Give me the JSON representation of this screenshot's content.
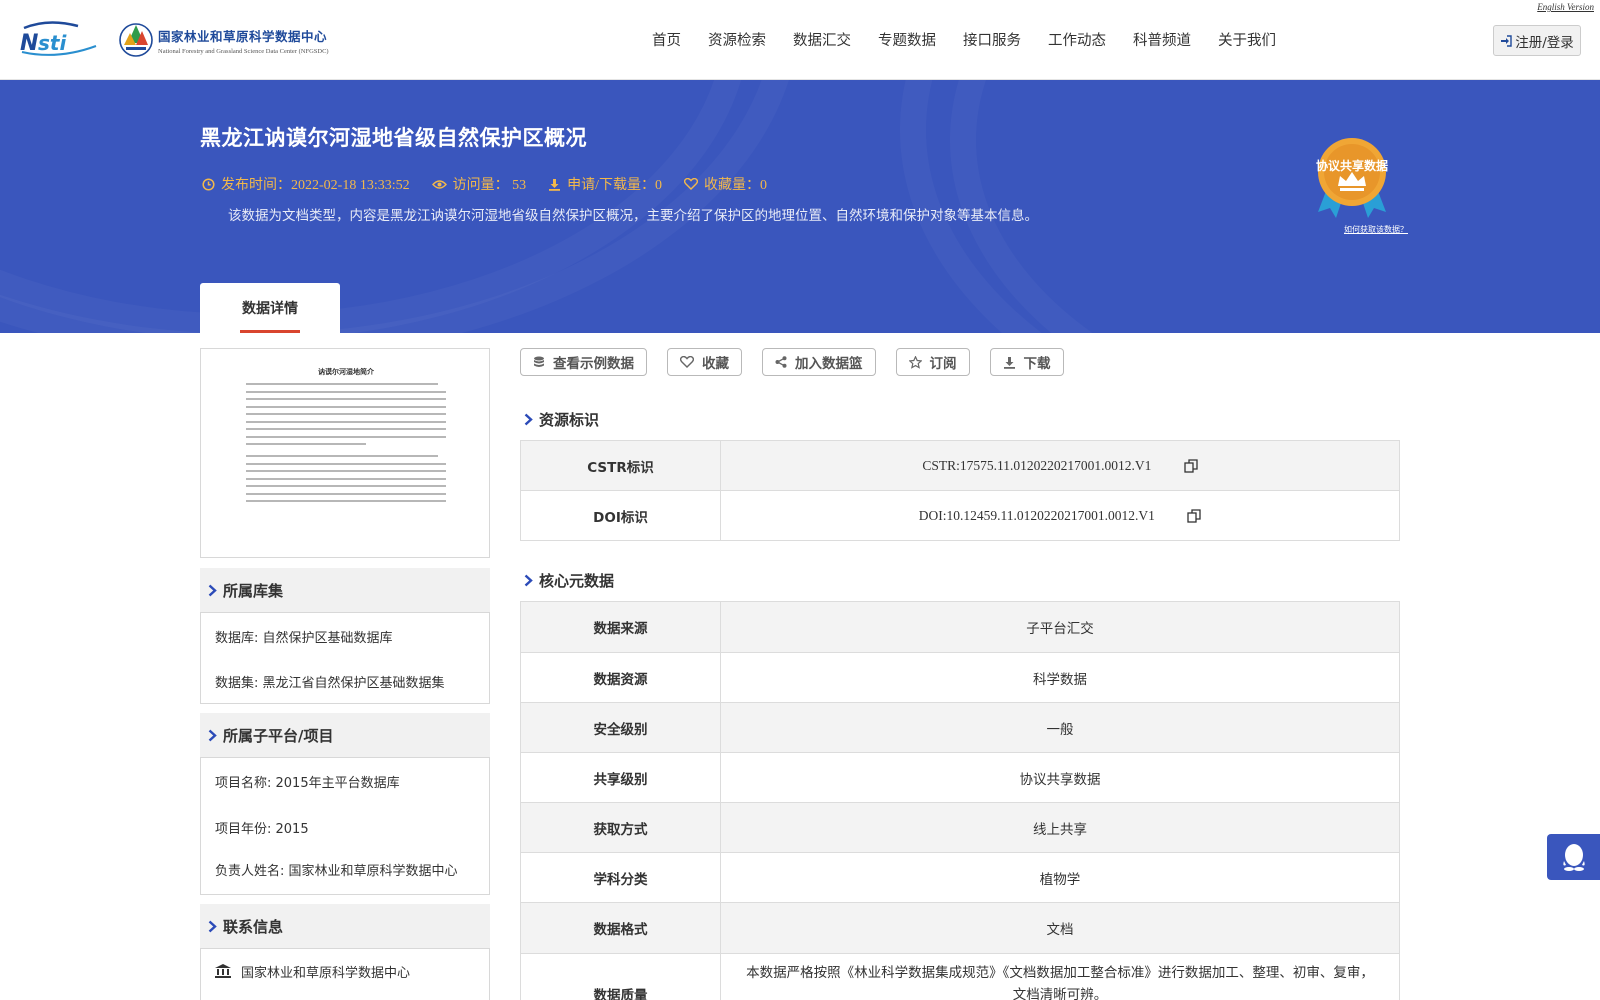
{
  "header": {
    "english_link": "English Version",
    "logo_cn": "国家林业和草原科学数据中心",
    "logo_en": "National Forestry and Grassland Science Data Center (NFGSDC)",
    "nav": [
      "首页",
      "资源检索",
      "数据汇交",
      "专题数据",
      "接口服务",
      "工作动态",
      "科普频道",
      "关于我们"
    ],
    "login_label": "注册/登录"
  },
  "banner": {
    "title": "黑龙江讷谟尔河湿地省级自然保护区概况",
    "publish_time": "发布时间：2022-02-18 13:33:52",
    "visits": "访问量： 53",
    "downloads": "申请/下载量：0",
    "favorites": "收藏量：0",
    "description": "该数据为文档类型，内容是黑龙江讷谟尔河湿地省级自然保护区概况，主要介绍了保护区的地理位置、自然环境和保护对象等基本信息。",
    "badge_label": "协议共享数据",
    "howto_link": "如何获取该数据？",
    "tab_label": "数据详情"
  },
  "thumbnail": {
    "title": "讷谟尔河湿地简介"
  },
  "library": {
    "title": "所属库集",
    "database": "数据库: 自然保护区基础数据库",
    "dataset": "数据集: 黑龙江省自然保护区基础数据集"
  },
  "project": {
    "title": "所属子平台/项目",
    "name": "项目名称: 2015年主平台数据库",
    "year": "项目年份: 2015",
    "owner": "负责人姓名: 国家林业和草原科学数据中心"
  },
  "contact": {
    "title": "联系信息",
    "org": "国家林业和草原科学数据中心"
  },
  "actions": {
    "sample": "查看示例数据",
    "favorite": "收藏",
    "basket": "加入数据篮",
    "subscribe": "订阅",
    "download": "下载"
  },
  "identifiers": {
    "title": "资源标识",
    "cstr_key": "CSTR标识",
    "cstr_value": "CSTR:17575.11.0120220217001.0012.V1",
    "doi_key": "DOI标识",
    "doi_value": "DOI:10.12459.11.0120220217001.0012.V1"
  },
  "core": {
    "title": "核心元数据",
    "rows": [
      {
        "key": "数据来源",
        "value": "子平台汇交"
      },
      {
        "key": "数据资源",
        "value": "科学数据"
      },
      {
        "key": "安全级别",
        "value": "一般"
      },
      {
        "key": "共享级别",
        "value": "协议共享数据"
      },
      {
        "key": "获取方式",
        "value": "线上共享"
      },
      {
        "key": "学科分类",
        "value": "植物学"
      },
      {
        "key": "数据格式",
        "value": "文档"
      },
      {
        "key": "数据质量",
        "value": "本数据严格按照《林业科学数据集成规范》《文档数据加工整合标准》进行数据加工、整理、初审、复审，文档清晰可辨。"
      }
    ]
  },
  "colors": {
    "banner_blue": "#3a56bd",
    "meta_orange": "#f2b84b",
    "tab_underline": "#d9452e"
  }
}
